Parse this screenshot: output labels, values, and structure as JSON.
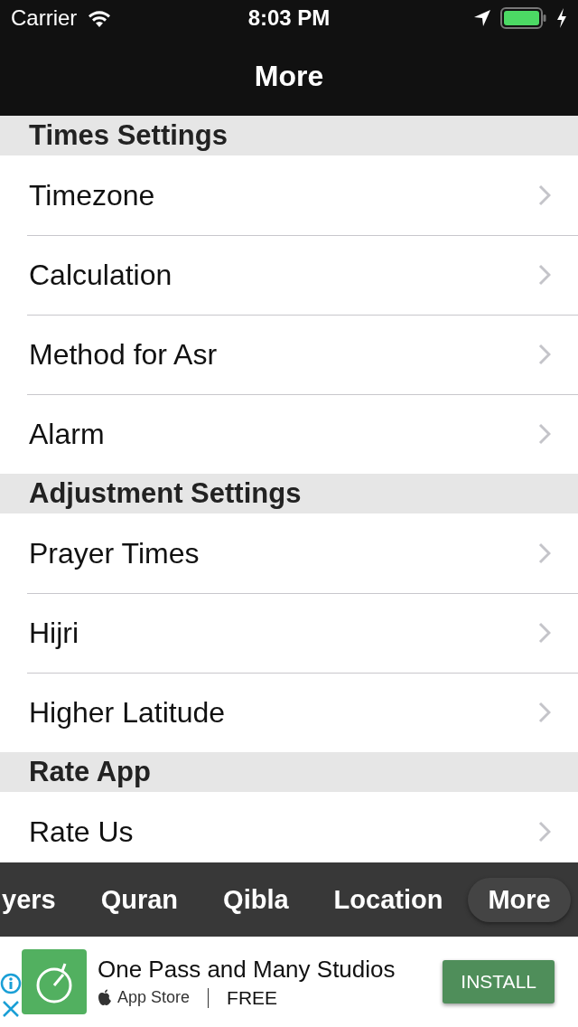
{
  "status_bar": {
    "carrier": "Carrier",
    "time": "8:03 PM"
  },
  "nav": {
    "title": "More"
  },
  "sections": [
    {
      "title": "Times Settings",
      "items": [
        "Timezone",
        "Calculation",
        "Method for Asr",
        "Alarm"
      ]
    },
    {
      "title": "Adjustment Settings",
      "items": [
        "Prayer Times",
        "Hijri",
        "Higher Latitude"
      ]
    },
    {
      "title": "Rate App",
      "items": [
        "Rate Us"
      ]
    }
  ],
  "tabs": [
    {
      "label": "yers",
      "selected": false
    },
    {
      "label": "Quran",
      "selected": false
    },
    {
      "label": "Qibla",
      "selected": false
    },
    {
      "label": "Location",
      "selected": false
    },
    {
      "label": "More",
      "selected": true
    }
  ],
  "ad": {
    "title": "One Pass and Many Studios",
    "store": "App Store",
    "price": "FREE",
    "button": "INSTALL"
  }
}
